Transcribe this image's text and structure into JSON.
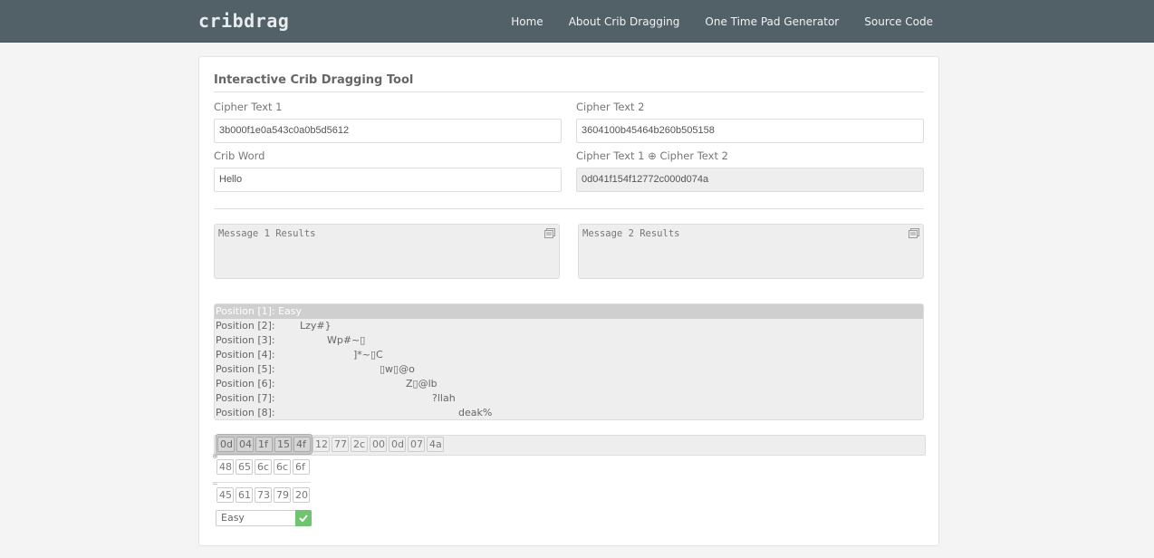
{
  "navbar": {
    "brand": "cribdrag",
    "links": [
      "Home",
      "About Crib Dragging",
      "One Time Pad Generator",
      "Source Code"
    ]
  },
  "panel": {
    "title": "Interactive Crib Dragging Tool",
    "cipher_text_1": {
      "label": "Cipher Text 1",
      "value": "3b000f1e0a543c0a0b5d5612"
    },
    "cipher_text_2": {
      "label": "Cipher Text 2",
      "value": "3604100b45464b260b505158"
    },
    "crib_word": {
      "label": "Crib Word",
      "value": "Hello"
    },
    "xor_result": {
      "label": "Cipher Text 1 ⊕ Cipher Text 2",
      "value": "0d041f154f12772c000d074a"
    },
    "message_1_results": "Message 1 Results",
    "message_2_results": "Message 2 Results"
  },
  "positions": {
    "selected_index": 0,
    "rows": [
      {
        "label": "Position [1]: Easy",
        "value": ""
      },
      {
        "label": "Position [2]:",
        "value": "Lzy#}"
      },
      {
        "label": "Position [3]:",
        "value": "Wp#~▯"
      },
      {
        "label": "Position [4]:",
        "value": "]*~▯C"
      },
      {
        "label": "Position [5]:",
        "value": "▯w▯@o"
      },
      {
        "label": "Position [6]:",
        "value": "Z▯@lb"
      },
      {
        "label": "Position [7]:",
        "value": "?llah"
      },
      {
        "label": "Position [8]:",
        "value": "deak%"
      }
    ]
  },
  "drag": {
    "xor_bytes": [
      "0d",
      "04",
      "1f",
      "15",
      "4f",
      "12",
      "77",
      "2c",
      "00",
      "0d",
      "07",
      "4a"
    ],
    "window_start": 0,
    "window_length": 5,
    "xor_op": "⊕",
    "crib_bytes": [
      "48",
      "65",
      "6c",
      "6c",
      "6f"
    ],
    "eq_op": "=",
    "result_bytes": [
      "45",
      "61",
      "73",
      "79",
      "20"
    ],
    "result_text": "Easy",
    "confirm_color": "#6fc46f"
  }
}
